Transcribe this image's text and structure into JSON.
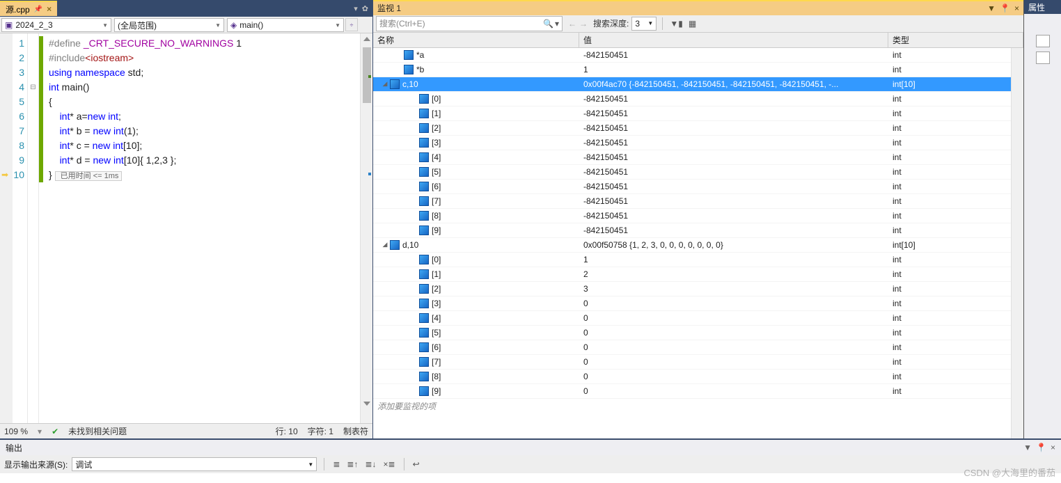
{
  "editor": {
    "tab_title": "源.cpp",
    "project_combo": "2024_2_3",
    "scope_combo": "(全局范围)",
    "func_combo": "main()",
    "zoom": "109 %",
    "status_ok": "未找到相关问题",
    "status_line": "行: 10",
    "status_char": "字符: 1",
    "status_tabs": "制表符",
    "elapsed": " 已用时间 <= 1ms",
    "lines": [
      {
        "n": "1",
        "html": "<span class='preproc'>#define </span><span class='pur'>_CRT_SECURE_NO_WARNINGS</span> 1"
      },
      {
        "n": "2",
        "html": "<span class='preproc'>#include</span><span class='str'>&lt;iostream&gt;</span>"
      },
      {
        "n": "3",
        "html": "<span class='kw'>using</span> <span class='kw'>namespace</span> std;"
      },
      {
        "n": "4",
        "html": "<span class='kw'>int</span> main()"
      },
      {
        "n": "5",
        "html": "{"
      },
      {
        "n": "6",
        "html": "    <span class='kw'>int</span>* a=<span class='kw'>new</span> <span class='kw'>int</span>;"
      },
      {
        "n": "7",
        "html": "    <span class='kw'>int</span>* b = <span class='kw'>new</span> <span class='kw'>int</span>(1);"
      },
      {
        "n": "8",
        "html": "    <span class='kw'>int</span>* c = <span class='kw'>new</span> <span class='kw'>int</span>[10];"
      },
      {
        "n": "9",
        "html": "    <span class='kw'>int</span>* d = <span class='kw'>new</span> <span class='kw'>int</span>[10]{ 1,2,3 };"
      },
      {
        "n": "10",
        "html": "}"
      }
    ]
  },
  "watch": {
    "title": "监视 1",
    "search_placeholder": "搜索(Ctrl+E)",
    "depth_label": "搜索深度:",
    "depth_value": "3",
    "col_name": "名称",
    "col_value": "值",
    "col_type": "类型",
    "add_hint": "添加要监视的项",
    "rows": [
      {
        "indent": 30,
        "exp": "",
        "name": "*a",
        "value": "-842150451",
        "type": "int",
        "sel": false
      },
      {
        "indent": 30,
        "exp": "",
        "name": "*b",
        "value": "1",
        "type": "int",
        "sel": false
      },
      {
        "indent": 10,
        "exp": "◢",
        "name": "c,10",
        "value": "0x00f4ac70 {-842150451, -842150451, -842150451, -842150451, -...",
        "type": "int[10]",
        "sel": true
      },
      {
        "indent": 52,
        "exp": "",
        "name": "[0]",
        "value": "-842150451",
        "type": "int",
        "sel": false
      },
      {
        "indent": 52,
        "exp": "",
        "name": "[1]",
        "value": "-842150451",
        "type": "int",
        "sel": false
      },
      {
        "indent": 52,
        "exp": "",
        "name": "[2]",
        "value": "-842150451",
        "type": "int",
        "sel": false
      },
      {
        "indent": 52,
        "exp": "",
        "name": "[3]",
        "value": "-842150451",
        "type": "int",
        "sel": false
      },
      {
        "indent": 52,
        "exp": "",
        "name": "[4]",
        "value": "-842150451",
        "type": "int",
        "sel": false
      },
      {
        "indent": 52,
        "exp": "",
        "name": "[5]",
        "value": "-842150451",
        "type": "int",
        "sel": false
      },
      {
        "indent": 52,
        "exp": "",
        "name": "[6]",
        "value": "-842150451",
        "type": "int",
        "sel": false
      },
      {
        "indent": 52,
        "exp": "",
        "name": "[7]",
        "value": "-842150451",
        "type": "int",
        "sel": false
      },
      {
        "indent": 52,
        "exp": "",
        "name": "[8]",
        "value": "-842150451",
        "type": "int",
        "sel": false
      },
      {
        "indent": 52,
        "exp": "",
        "name": "[9]",
        "value": "-842150451",
        "type": "int",
        "sel": false
      },
      {
        "indent": 10,
        "exp": "◢",
        "name": "d,10",
        "value": "0x00f50758 {1, 2, 3, 0, 0, 0, 0, 0, 0, 0}",
        "type": "int[10]",
        "sel": false
      },
      {
        "indent": 52,
        "exp": "",
        "name": "[0]",
        "value": "1",
        "type": "int",
        "sel": false
      },
      {
        "indent": 52,
        "exp": "",
        "name": "[1]",
        "value": "2",
        "type": "int",
        "sel": false
      },
      {
        "indent": 52,
        "exp": "",
        "name": "[2]",
        "value": "3",
        "type": "int",
        "sel": false
      },
      {
        "indent": 52,
        "exp": "",
        "name": "[3]",
        "value": "0",
        "type": "int",
        "sel": false
      },
      {
        "indent": 52,
        "exp": "",
        "name": "[4]",
        "value": "0",
        "type": "int",
        "sel": false
      },
      {
        "indent": 52,
        "exp": "",
        "name": "[5]",
        "value": "0",
        "type": "int",
        "sel": false
      },
      {
        "indent": 52,
        "exp": "",
        "name": "[6]",
        "value": "0",
        "type": "int",
        "sel": false
      },
      {
        "indent": 52,
        "exp": "",
        "name": "[7]",
        "value": "0",
        "type": "int",
        "sel": false
      },
      {
        "indent": 52,
        "exp": "",
        "name": "[8]",
        "value": "0",
        "type": "int",
        "sel": false
      },
      {
        "indent": 52,
        "exp": "",
        "name": "[9]",
        "value": "0",
        "type": "int",
        "sel": false
      }
    ]
  },
  "props": {
    "title": "属性"
  },
  "output": {
    "title": "输出",
    "src_label": "显示输出来源(S):",
    "src_value": "调试"
  },
  "watermark": "CSDN @大海里的番茄"
}
